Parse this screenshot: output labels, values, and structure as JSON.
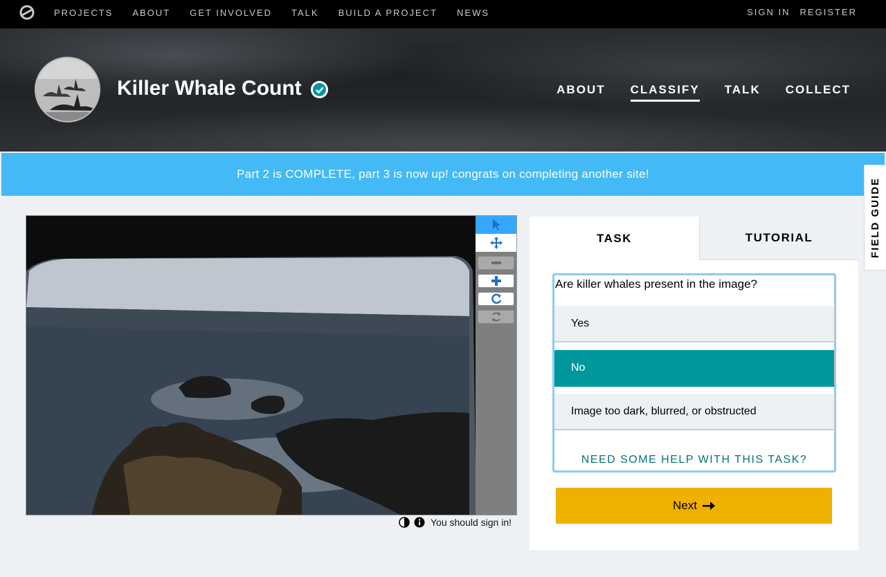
{
  "topnav": {
    "logo_icon": "zooniverse-logo-icon",
    "links": [
      "PROJECTS",
      "ABOUT",
      "GET INVOLVED",
      "TALK",
      "BUILD A PROJECT",
      "NEWS"
    ],
    "sign_in": "SIGN IN",
    "register": "REGISTER"
  },
  "project": {
    "title": "Killer Whale Count",
    "verified_icon": "verified-check-icon",
    "nav": [
      "ABOUT",
      "CLASSIFY",
      "TALK",
      "COLLECT"
    ],
    "active_nav": "CLASSIFY"
  },
  "banner": {
    "text": "Part 2 is COMPLETE, part 3 is now up! congrats on completing another site!",
    "color": "#43b9f6"
  },
  "field_guide": {
    "label": "FIELD GUIDE"
  },
  "viewer": {
    "tools": [
      "pointer-icon",
      "pan-icon",
      "zoom-out-icon",
      "zoom-in-icon",
      "rotate-icon",
      "reset-icon"
    ],
    "selected_tool": "pointer-icon",
    "meta_icons": [
      "contrast-icon",
      "info-icon"
    ],
    "signin_hint": "You should sign in!"
  },
  "task": {
    "tabs": {
      "task": "TASK",
      "tutorial": "TUTORIAL"
    },
    "question": "Are killer whales present in the image?",
    "answers": [
      "Yes",
      "No",
      "Image too dark, blurred, or obstructed"
    ],
    "selected_answer": "No",
    "help": "NEED SOME HELP WITH THIS TASK?",
    "next": "Next",
    "next_color": "#efb100",
    "selected_color": "#00979d"
  }
}
